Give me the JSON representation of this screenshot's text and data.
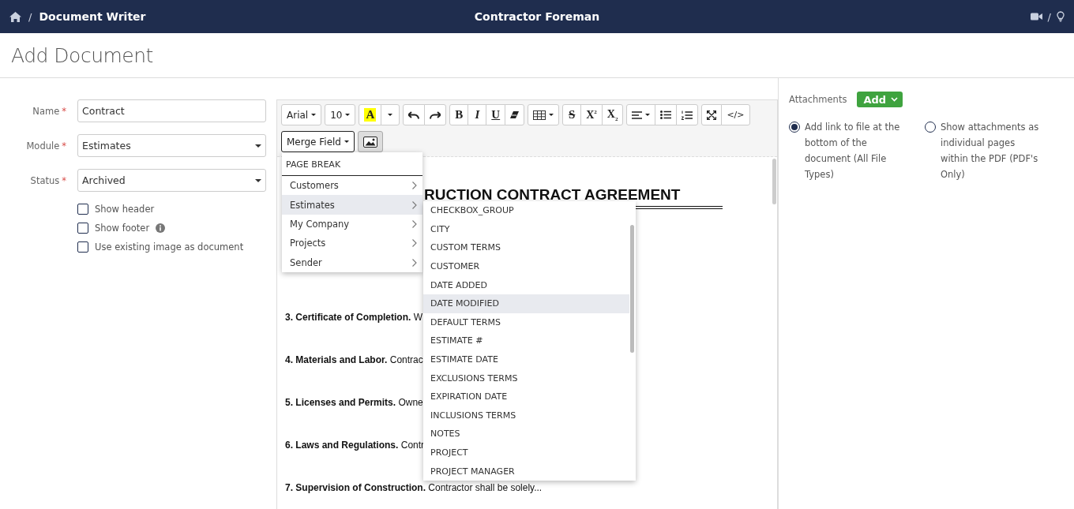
{
  "header": {
    "breadcrumb": "Document Writer",
    "breadcrumb_separator": "/",
    "app_title": "Contractor Foreman",
    "icon_separator": "/"
  },
  "page_title": "Add Document",
  "form": {
    "fields": [
      {
        "label": "Name",
        "required_mark": "*",
        "kind": "input",
        "value": "Contract"
      },
      {
        "label": "Module",
        "required_mark": "*",
        "kind": "select",
        "value": "Estimates"
      },
      {
        "label": "Status",
        "required_mark": "*",
        "kind": "select",
        "value": "Archived"
      }
    ],
    "checkboxes": [
      {
        "label": "Show header",
        "checked": false,
        "info": false
      },
      {
        "label": "Show footer",
        "checked": false,
        "info": true
      },
      {
        "label": "Use existing image as document",
        "checked": false,
        "info": false
      }
    ]
  },
  "editor": {
    "toolbar": {
      "rows": [
        [
          [
            {
              "kind": "text",
              "label": "Arial",
              "caret": true
            }
          ],
          [
            {
              "kind": "text",
              "label": "10",
              "caret": true
            }
          ],
          [
            {
              "kind": "highlight",
              "label": "A",
              "caret": false
            },
            {
              "kind": "caret"
            }
          ],
          [
            {
              "kind": "icon"
            },
            {
              "kind": "icon"
            }
          ],
          [
            {
              "kind": "bold",
              "label": "B"
            },
            {
              "kind": "italic",
              "label": "I"
            },
            {
              "kind": "underline",
              "label": "U"
            },
            {
              "kind": "icon"
            }
          ],
          [
            {
              "kind": "icon",
              "caret": true
            }
          ],
          [
            {
              "kind": "strike",
              "label": "S"
            },
            {
              "kind": "superscript",
              "label": "X$^{2}$"
            },
            {
              "kind": "subscript",
              "label": "X$_{2}$"
            }
          ],
          [
            {
              "kind": "icon",
              "caret": true
            },
            {
              "kind": "icon"
            },
            {
              "kind": "icon"
            }
          ],
          [
            {
              "kind": "icon"
            },
            {
              "kind": "code",
              "label": "</>"
            }
          ]
        ],
        [
          [
            {
              "kind": "text",
              "label": "Merge Field",
              "caret": true,
              "open": true
            }
          ],
          [
            {
              "kind": "icon",
              "pressed": true
            }
          ]
        ]
      ]
    },
    "heading": "RUCTION CONTRACT AGREEMENT",
    "paragraphs": [
      "**3. Certificate of Completion.** W",
      "**4. Materials and Labor.** Contrac",
      "**5. Licenses and Permits.** Owne",
      "**6. Laws and Regulations.** Contr",
      "**7. Supervision of Construction.** Contractor shall be solely..."
    ]
  },
  "merge_menu": {
    "header": "PAGE BREAK",
    "categories": [
      {
        "label": "Customers",
        "selected": false
      },
      {
        "label": "Estimates",
        "selected": true
      },
      {
        "label": "My Company",
        "selected": false
      },
      {
        "label": "Projects",
        "selected": false
      },
      {
        "label": "Sender",
        "selected": false
      }
    ],
    "fields": [
      {
        "label": "CHECKBOX_GROUP",
        "selected": false
      },
      {
        "label": "CITY",
        "selected": false
      },
      {
        "label": "CUSTOM TERMS",
        "selected": false
      },
      {
        "label": "CUSTOMER",
        "selected": false
      },
      {
        "label": "DATE ADDED",
        "selected": false
      },
      {
        "label": "DATE MODIFIED",
        "selected": true
      },
      {
        "label": "DEFAULT TERMS",
        "selected": false
      },
      {
        "label": "ESTIMATE #",
        "selected": false
      },
      {
        "label": "ESTIMATE DATE",
        "selected": false
      },
      {
        "label": "EXCLUSIONS TERMS",
        "selected": false
      },
      {
        "label": "EXPIRATION DATE",
        "selected": false
      },
      {
        "label": "INCLUSIONS TERMS",
        "selected": false
      },
      {
        "label": "NOTES",
        "selected": false
      },
      {
        "label": "PROJECT",
        "selected": false
      },
      {
        "label": "PROJECT MANAGER",
        "selected": false
      }
    ]
  },
  "attachments": {
    "label": "Attachments",
    "add_button": "Add",
    "options": [
      {
        "label": "Add link to file at the bottom of the document (All File Types)",
        "selected": true
      },
      {
        "label": "Show attachments as individual pages within the PDF (PDF's Only)",
        "selected": false
      }
    ]
  }
}
